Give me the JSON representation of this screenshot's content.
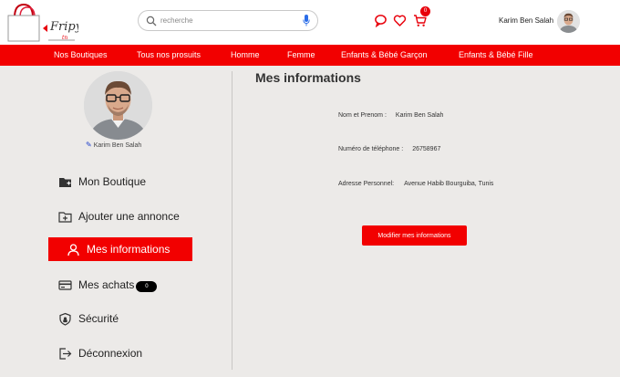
{
  "header": {
    "logo_text": "Fripy",
    "search": {
      "placeholder": "recherche",
      "value": ""
    },
    "cart_count": "0",
    "user_name": "Karim Ben Salah"
  },
  "nav": {
    "items": [
      {
        "label": "Nos Boutiques"
      },
      {
        "label": "Tous nos prosuits"
      },
      {
        "label": "Homme"
      },
      {
        "label": "Femme"
      },
      {
        "label": "Enfants & Bébé Garçon"
      },
      {
        "label": "Enfants & Bébé Fille"
      }
    ]
  },
  "sidebar": {
    "profile_name": "Karim Ben Salah",
    "items": [
      {
        "label": "Mon Boutique",
        "icon": "folder-plus-icon"
      },
      {
        "label": "Ajouter une annonce",
        "icon": "add-listing-icon"
      },
      {
        "label": "Mes informations",
        "icon": "user-icon",
        "active": true
      },
      {
        "label": "Mes achats",
        "icon": "credit-card-icon",
        "badge": "0"
      },
      {
        "label": "Sécurité",
        "icon": "shield-icon"
      },
      {
        "label": "Déconnexion",
        "icon": "logout-icon"
      }
    ]
  },
  "main": {
    "title": "Mes informations",
    "fields": [
      {
        "label": "Nom et Prenom :",
        "value": "Karim Ben Salah"
      },
      {
        "label": "Numéro de téléphone :",
        "value": "26758967"
      },
      {
        "label": "Adresse Personnel:",
        "value": "Avenue Habib Bourguiba, Tunis"
      }
    ],
    "modify_button": "Modifier mes informations"
  },
  "colors": {
    "accent": "#f20000",
    "background": "#eceae8",
    "header": "#ffffff"
  }
}
